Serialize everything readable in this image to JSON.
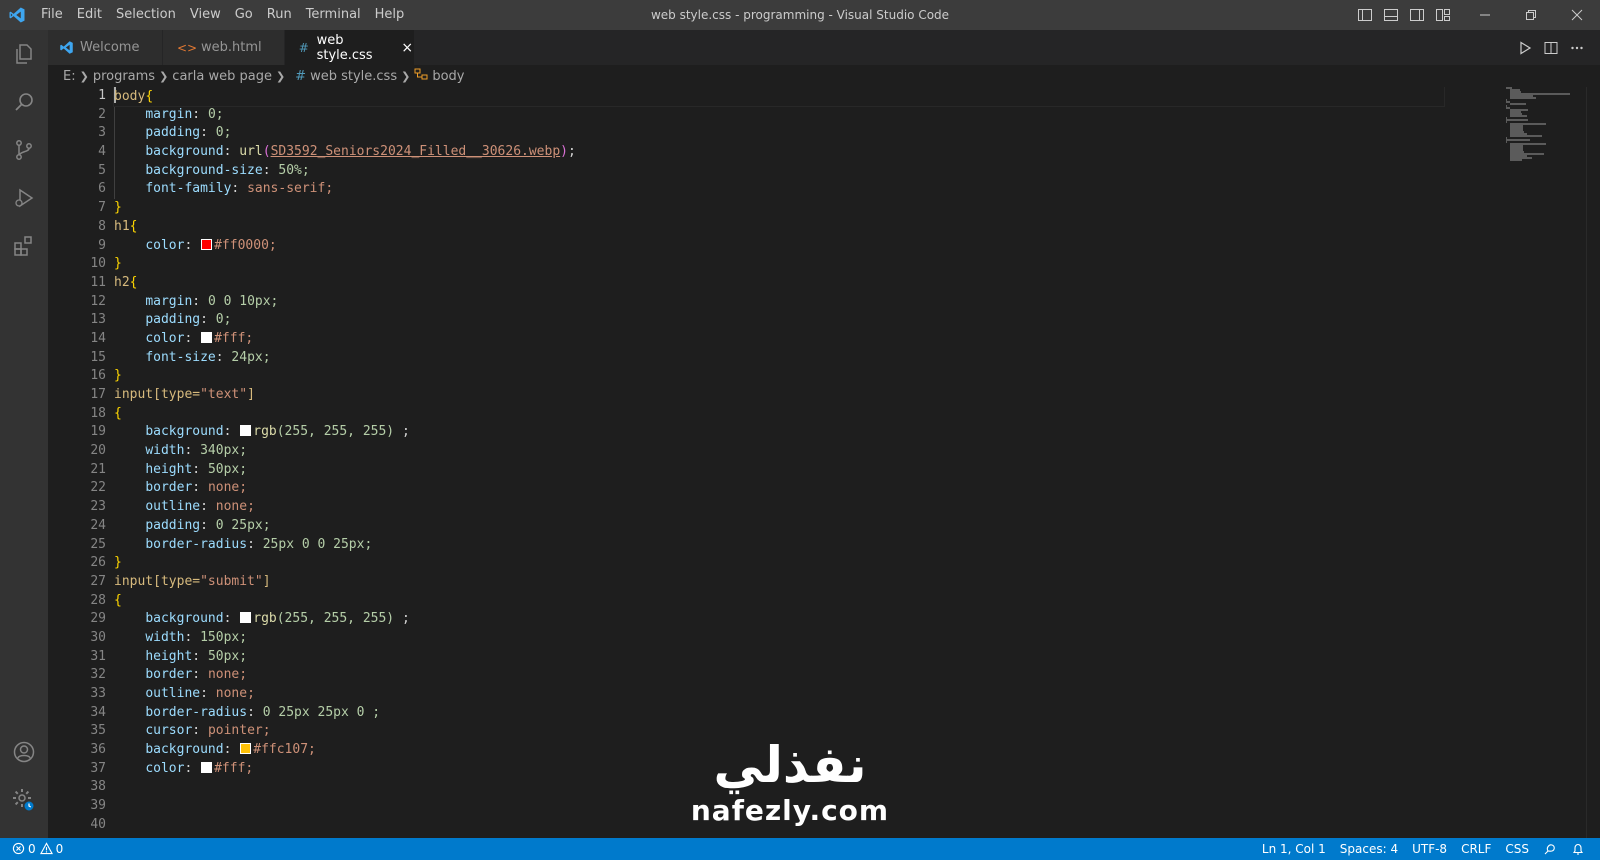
{
  "window": {
    "title": "web style.css - programming - Visual Studio Code",
    "accent": "#007acc"
  },
  "menu": [
    "File",
    "Edit",
    "Selection",
    "View",
    "Go",
    "Run",
    "Terminal",
    "Help"
  ],
  "tabs": [
    {
      "label": "Welcome",
      "icon": "vscode-icon",
      "active": false
    },
    {
      "label": "web.html",
      "icon": "html-icon",
      "active": false
    },
    {
      "label": "web style.css",
      "icon": "css-hash-icon",
      "active": true,
      "close": "×"
    }
  ],
  "breadcrumb": {
    "items": [
      "E:",
      "programs",
      "carla web page",
      "web style.css",
      "body"
    ],
    "file_icon": "#"
  },
  "editor": {
    "current_line": 1,
    "line_numbers": [
      "1",
      "2",
      "3",
      "4",
      "5",
      "6",
      "7",
      "8",
      "9",
      "10",
      "11",
      "12",
      "13",
      "14",
      "15",
      "16",
      "17",
      "18",
      "19",
      "20",
      "21",
      "22",
      "23",
      "24",
      "25",
      "26",
      "27",
      "28",
      "29",
      "30",
      "31",
      "32",
      "33",
      "34",
      "35",
      "36",
      "37",
      "38",
      "39",
      "40"
    ],
    "swatches": {
      "h1_color": "#ff0000",
      "h2_color": "#ffffff",
      "input_text_bg": "#ffffff",
      "input_submit_bg": "#ffffff",
      "submit_bg2": "#ffc107",
      "submit_color": "#ffffff"
    },
    "lines": [
      [
        "body",
        "{"
      ],
      [
        "margin",
        "0;"
      ],
      [
        "padding",
        "0;"
      ],
      [
        "background",
        "url(",
        "SD3592_Seniors2024_Filled__30626.webp",
        ");"
      ],
      [
        "background-size",
        "50%;"
      ],
      [
        "font-family",
        "sans-serif;"
      ],
      [
        "}"
      ],
      [
        "h1",
        "{"
      ],
      [
        "color",
        "#ff0000;"
      ],
      [
        "}"
      ],
      [
        "h2",
        "{"
      ],
      [
        "margin",
        "0 0 10px;"
      ],
      [
        "padding",
        "0;"
      ],
      [
        "color",
        "#fff;"
      ],
      [
        "font-size",
        "24px;"
      ],
      [
        "}"
      ],
      [
        "input[type=",
        "\"text\"",
        "]"
      ],
      [
        "{"
      ],
      [
        "background",
        "rgb",
        "(255, 255, 255)",
        " ;"
      ],
      [
        "width",
        "340px;"
      ],
      [
        "height",
        "50px;"
      ],
      [
        "border",
        "none;"
      ],
      [
        "outline",
        "none;"
      ],
      [
        "padding",
        "0 25px;"
      ],
      [
        "border-radius",
        "25px 0 0 25px;"
      ],
      [
        "}"
      ],
      [
        "input[type=",
        "\"submit\"",
        "]"
      ],
      [
        "{"
      ],
      [
        "background",
        "rgb",
        "(255, 255, 255)",
        " ;"
      ],
      [
        "width",
        "150px;"
      ],
      [
        "height",
        "50px;"
      ],
      [
        "border",
        "none;"
      ],
      [
        "outline",
        "none;"
      ],
      [
        "border-radius",
        "0 25px 25px 0 ;"
      ],
      [
        "cursor",
        "pointer;"
      ],
      [
        "background",
        "#ffc107;"
      ],
      [
        "color",
        "#fff;"
      ]
    ]
  },
  "watermark": {
    "arabic": "نفذلي",
    "latin": "nafezly.com"
  },
  "statusbar": {
    "errors": "0",
    "warnings": "0",
    "position": "Ln 1, Col 1",
    "spaces": "Spaces: 4",
    "encoding": "UTF-8",
    "eol": "CRLF",
    "language": "CSS"
  }
}
